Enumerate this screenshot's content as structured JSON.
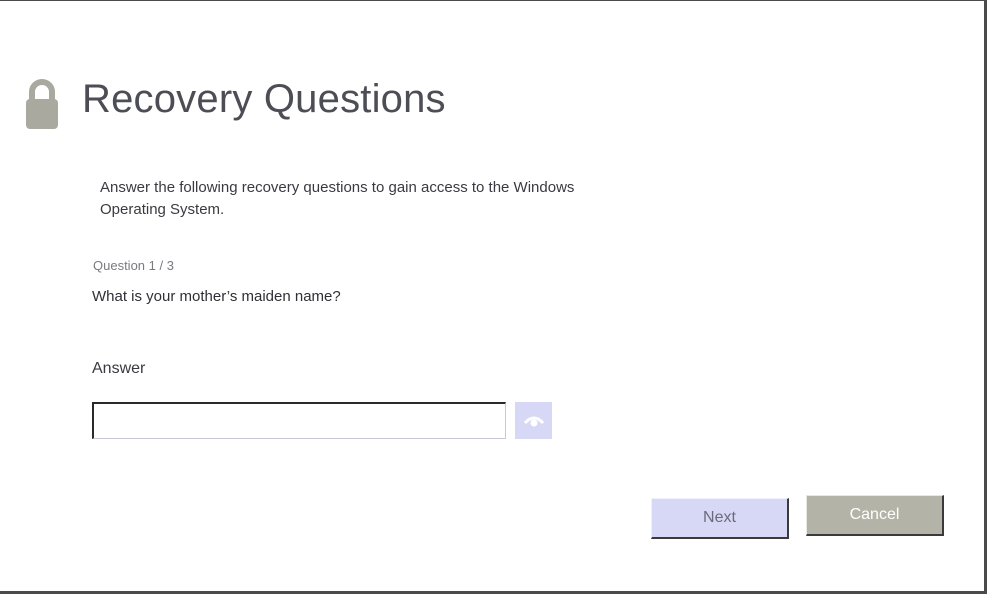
{
  "header": {
    "title": "Recovery Questions",
    "icon": "lock-icon"
  },
  "intro": {
    "text": "Answer the following recovery questions to gain access to the Windows Operating System."
  },
  "question": {
    "counter": "Question 1 / 3",
    "text": "What is your mother’s maiden name?"
  },
  "answer": {
    "label": "Answer",
    "value": "",
    "reveal_icon": "eye-icon"
  },
  "buttons": {
    "next_label": "Next",
    "cancel_label": "Cancel"
  },
  "colors": {
    "accent": "#d7d8f6",
    "cancel": "#b3b3a8",
    "title_text": "#4d4d55",
    "lock_icon": "#a9a9a0"
  }
}
